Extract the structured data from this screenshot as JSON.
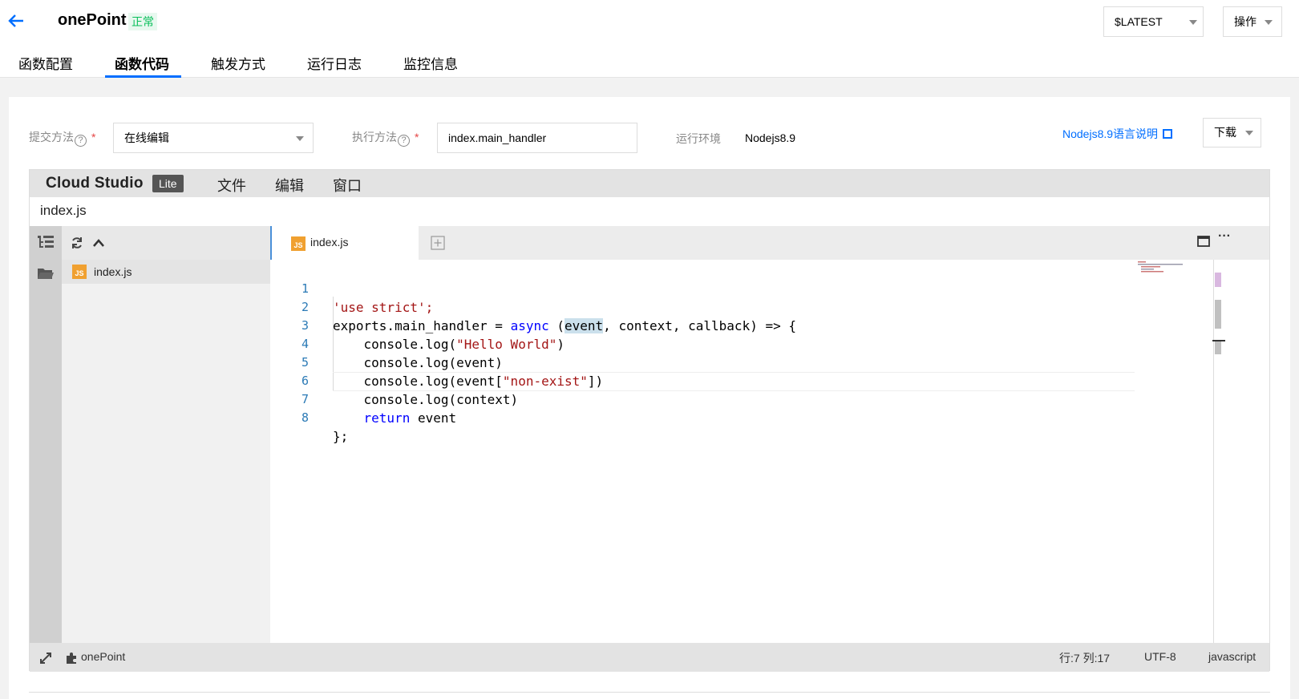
{
  "header": {
    "function_name": "onePoint",
    "status": "正常",
    "version": "$LATEST",
    "operations": "操作"
  },
  "tabs": [
    {
      "label": "函数配置"
    },
    {
      "label": "函数代码"
    },
    {
      "label": "触发方式"
    },
    {
      "label": "运行日志"
    },
    {
      "label": "监控信息"
    }
  ],
  "form": {
    "submit_label": "提交方法",
    "submit_value": "在线编辑",
    "exec_label": "执行方法",
    "exec_value": "index.main_handler",
    "runtime_label": "运行环境",
    "runtime_value": "Nodejs8.9",
    "doc_link": "Nodejs8.9语言说明",
    "download": "下载",
    "help": "?",
    "required": "*"
  },
  "ide": {
    "brand": "Cloud Studio",
    "badge": "Lite",
    "menu": [
      "文件",
      "编辑",
      "窗口"
    ],
    "current_file": "index.js",
    "file_tree": [
      {
        "name": "index.js",
        "icon": "js-file-icon"
      }
    ],
    "open_tab": "index.js",
    "file_icon_text": "JS",
    "code_lines": [
      {
        "n": "1",
        "text": "'use strict';"
      },
      {
        "n": "2",
        "text": "exports.main_handler = async (event, context, callback) => {"
      },
      {
        "n": "3",
        "text": "    console.log(\"Hello World\")"
      },
      {
        "n": "4",
        "text": "    console.log(event)"
      },
      {
        "n": "5",
        "text": "    console.log(event[\"non-exist\"])"
      },
      {
        "n": "6",
        "text": "    console.log(context)"
      },
      {
        "n": "7",
        "text": "    return event"
      },
      {
        "n": "8",
        "text": "};"
      }
    ],
    "status": {
      "project": "onePoint",
      "cursor": "行:7 列:17",
      "encoding": "UTF-8",
      "language": "javascript"
    }
  },
  "colors": {
    "accent": "#006eff",
    "status_green": "#0abf5b",
    "line_number": "#2b7ab6",
    "string": "#a31515",
    "keyword": "#0000ff"
  }
}
